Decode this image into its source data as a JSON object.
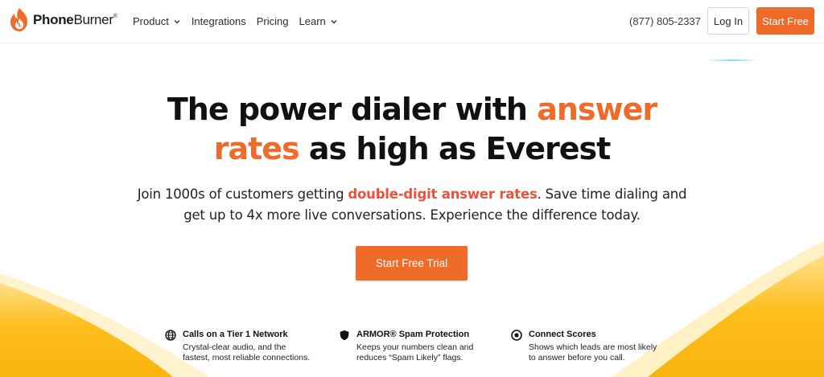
{
  "brand": {
    "name_bold": "Phone",
    "name_regular": "Burner",
    "trademark": "®",
    "accent_color": "#f06a2a",
    "logo_icon": "flame-logo-icon"
  },
  "nav": {
    "items": [
      {
        "label": "Product",
        "has_dropdown": true
      },
      {
        "label": "Integrations",
        "has_dropdown": false
      },
      {
        "label": "Pricing",
        "has_dropdown": false
      },
      {
        "label": "Learn",
        "has_dropdown": true
      }
    ],
    "phone": "(877) 805-2337",
    "login_label": "Log In",
    "start_label": "Start Free"
  },
  "hero": {
    "line1_a": "The power dialer with ",
    "line1_b": "answer",
    "line2_a": "rates",
    "line2_b": " as high as Everest",
    "sub_a": "Join 1000s of customers getting ",
    "sub_hl": "double-digit answer rates",
    "sub_b": ". Save time dialing and",
    "sub_line2": "get up to 4x more live conversations. Experience the difference today.",
    "cta_label": "Start Free Trial"
  },
  "features": [
    {
      "icon": "globe-icon",
      "title": "Calls on a Tier 1 Network",
      "desc1": "Crystal-clear audio, and the",
      "desc2": "fastest, most reliable connections."
    },
    {
      "icon": "shield-icon",
      "title": "ARMOR® Spam Protection",
      "desc1": "Keeps your numbers clean and",
      "desc2": "reduces “Spam Likely” flags."
    },
    {
      "icon": "target-icon",
      "title": "Connect Scores",
      "desc1": "Shows which leads are most likely",
      "desc2": "to answer before you call."
    }
  ],
  "colors": {
    "wave_yellow": "#fbb91a",
    "wave_light": "#ffe7a6",
    "highlight_red": "#e8533a"
  }
}
